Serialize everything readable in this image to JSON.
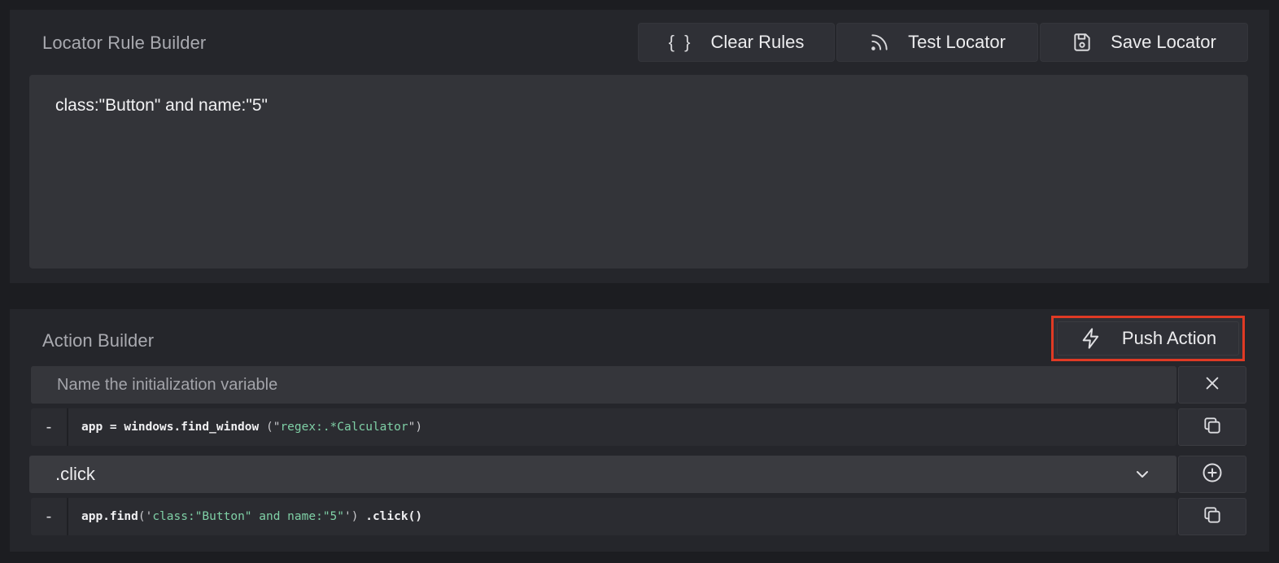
{
  "locator": {
    "title": "Locator Rule Builder",
    "clear_label": "Clear Rules",
    "test_label": "Test Locator",
    "save_label": "Save Locator",
    "rule_text": "class:\"Button\" and name:\"5\"",
    "clear_icon_text": "{ }"
  },
  "action": {
    "title": "Action Builder",
    "push_label": "Push Action",
    "init_placeholder": "Name the initialization variable",
    "code_line_1": {
      "prefix": "-",
      "head": "app = windows.find_window",
      "open": "(\"",
      "arg": "regex:.*Calculator",
      "close": "\")"
    },
    "select_value": ".click",
    "code_line_2": {
      "prefix": "-",
      "head": "app.find",
      "open": "('",
      "arg": "class:\"Button\" and name:\"5\"",
      "close": "')",
      "tail": ".click()"
    }
  },
  "colors": {
    "accent_highlight": "#e03a24",
    "string_green": "#7fd0a6"
  },
  "icons": [
    "braces-icon",
    "rss-icon",
    "save-icon",
    "lightning-icon",
    "close-icon",
    "copy-icon",
    "chevron-down-icon",
    "plus-circle-icon"
  ]
}
